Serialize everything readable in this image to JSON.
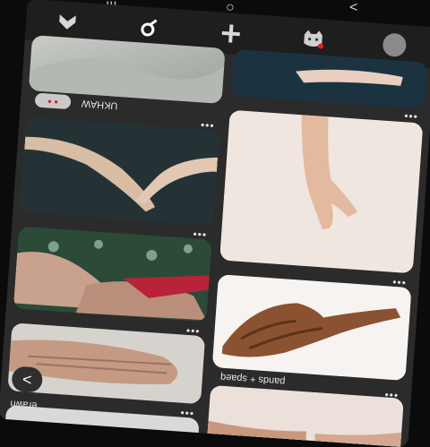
{
  "system_nav": {
    "menu": "|||",
    "home": "○",
    "back": "<"
  },
  "app_bar": {
    "tabs": [
      {
        "icon": "heart-icon"
      },
      {
        "icon": "search-icon"
      },
      {
        "icon": "add-icon"
      },
      {
        "icon": "cat-profile-icon"
      },
      {
        "icon": "avatar-icon"
      }
    ]
  },
  "pins": {
    "top_left": {
      "more": "•••",
      "caption": "UKHAW"
    },
    "hands_wrists": {
      "more": "•••"
    },
    "elderly_hands": {
      "more": "•••"
    },
    "folded_hands": {
      "more": "•••"
    },
    "hand_upright": {
      "more": "•••"
    },
    "wooden_sculpture": {
      "more": "•••",
      "caption": "pands + spaeq"
    },
    "bottom_right": {
      "more": "•••"
    }
  },
  "footer": {
    "back_label": "<",
    "bottom_text": "erawh"
  }
}
